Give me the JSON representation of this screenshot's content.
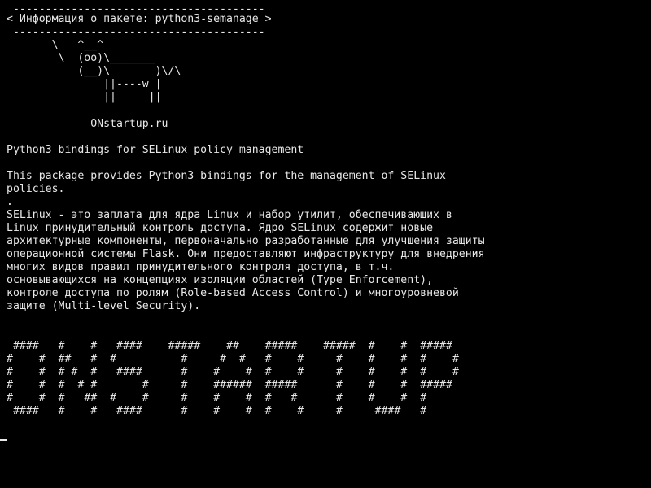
{
  "terminal": {
    "lines": [
      " ---------------------------------------",
      "< Информация о пакете: python3-semanage >",
      " ---------------------------------------",
      "       \\   ^__^",
      "        \\  (oo)\\_______",
      "           (__)\\       )\\/\\",
      "               ||----w |",
      "               ||     ||",
      "",
      "             ONstartup.ru",
      "",
      "Python3 bindings for SELinux policy management",
      "",
      "This package provides Python3 bindings for the management of SELinux",
      "policies.",
      ".",
      "SELinux - это заплата для ядра Linux и набор утилит, обеспечивающих в",
      "Linux принудительный контроль доступа. Ядро SELinux содержит новые",
      "архитектурные компоненты, первоначально разработанные для улучшения защиты",
      "операционной системы Flask. Они предоставляют инфраструктуру для внедрения",
      "многих видов правил принудительного контроля доступа, в т.ч.",
      "основывающихся на концепциях изоляции областей (Type Enforcement),",
      "контроле доступа по ролям (Role-based Access Control) и многоуровневой",
      "защите (Multi-level Security).",
      "",
      "",
      " ####   #    #   ####    #####    ##    #####    #####  #    #  #####",
      "#    #  ##   #  #          #     #  #   #    #     #    #    #  #    #",
      "#    #  # #  #   ####      #    #    #  #    #     #    #    #  #    #",
      "#    #  #  # #       #     #    ######  #####      #    #    #  #####",
      "#    #  #   ##  #    #     #    #    #  #   #      #    #    #  #",
      " ####   #    #   ####      #    #    #  #    #     #     ####   #"
    ]
  }
}
